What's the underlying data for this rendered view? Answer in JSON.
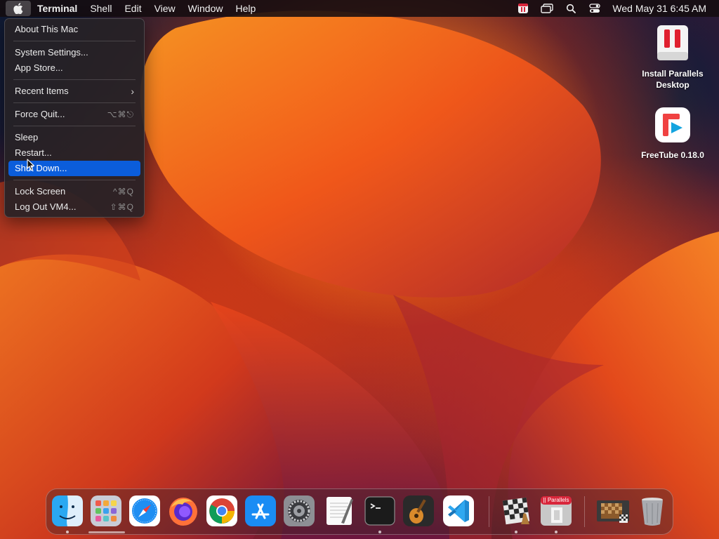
{
  "menubar": {
    "apple_icon": "apple-logo-icon",
    "app_name": "Terminal",
    "menus": [
      "Shell",
      "Edit",
      "View",
      "Window",
      "Help"
    ],
    "status_icons": [
      "parallels-status-icon",
      "window-switcher-icon",
      "spotlight-search-icon",
      "control-center-icon"
    ],
    "clock": "Wed May 31  6:45 AM"
  },
  "apple_menu": {
    "items": [
      {
        "label": "About This Mac"
      },
      {
        "label": "System Settings..."
      },
      {
        "label": "App Store..."
      },
      {
        "label": "Recent Items",
        "submenu": "chevron-right-icon"
      },
      {
        "label": "Force Quit...",
        "shortcut": "⌥⌘⎋"
      },
      {
        "label": "Sleep"
      },
      {
        "label": "Restart..."
      },
      {
        "label": "Shut Down...",
        "highlighted": true
      },
      {
        "label": "Lock Screen",
        "shortcut": "^⌘Q"
      },
      {
        "label": "Log Out VM4...",
        "shortcut": "⇧⌘Q"
      }
    ],
    "highlight_color": "#0b5ddb"
  },
  "desktop": {
    "icons": [
      {
        "label_line1": "Install Parallels",
        "label_line2": "Desktop",
        "icon": "parallels-installer-icon"
      },
      {
        "label_line1": "FreeTube 0.18.0",
        "icon": "freetube-icon"
      }
    ]
  },
  "dock": {
    "apps": [
      "finder-icon",
      "launchpad-icon",
      "safari-icon",
      "firefox-icon",
      "chrome-icon",
      "app-store-icon",
      "system-settings-icon",
      "textedit-icon",
      "terminal-icon",
      "garageband-icon",
      "vscode-icon",
      "chess-icon",
      "parallels-desktop-icon",
      "chess-window-icon",
      "trash-icon"
    ],
    "parallels_badge": "|| Parallels"
  }
}
